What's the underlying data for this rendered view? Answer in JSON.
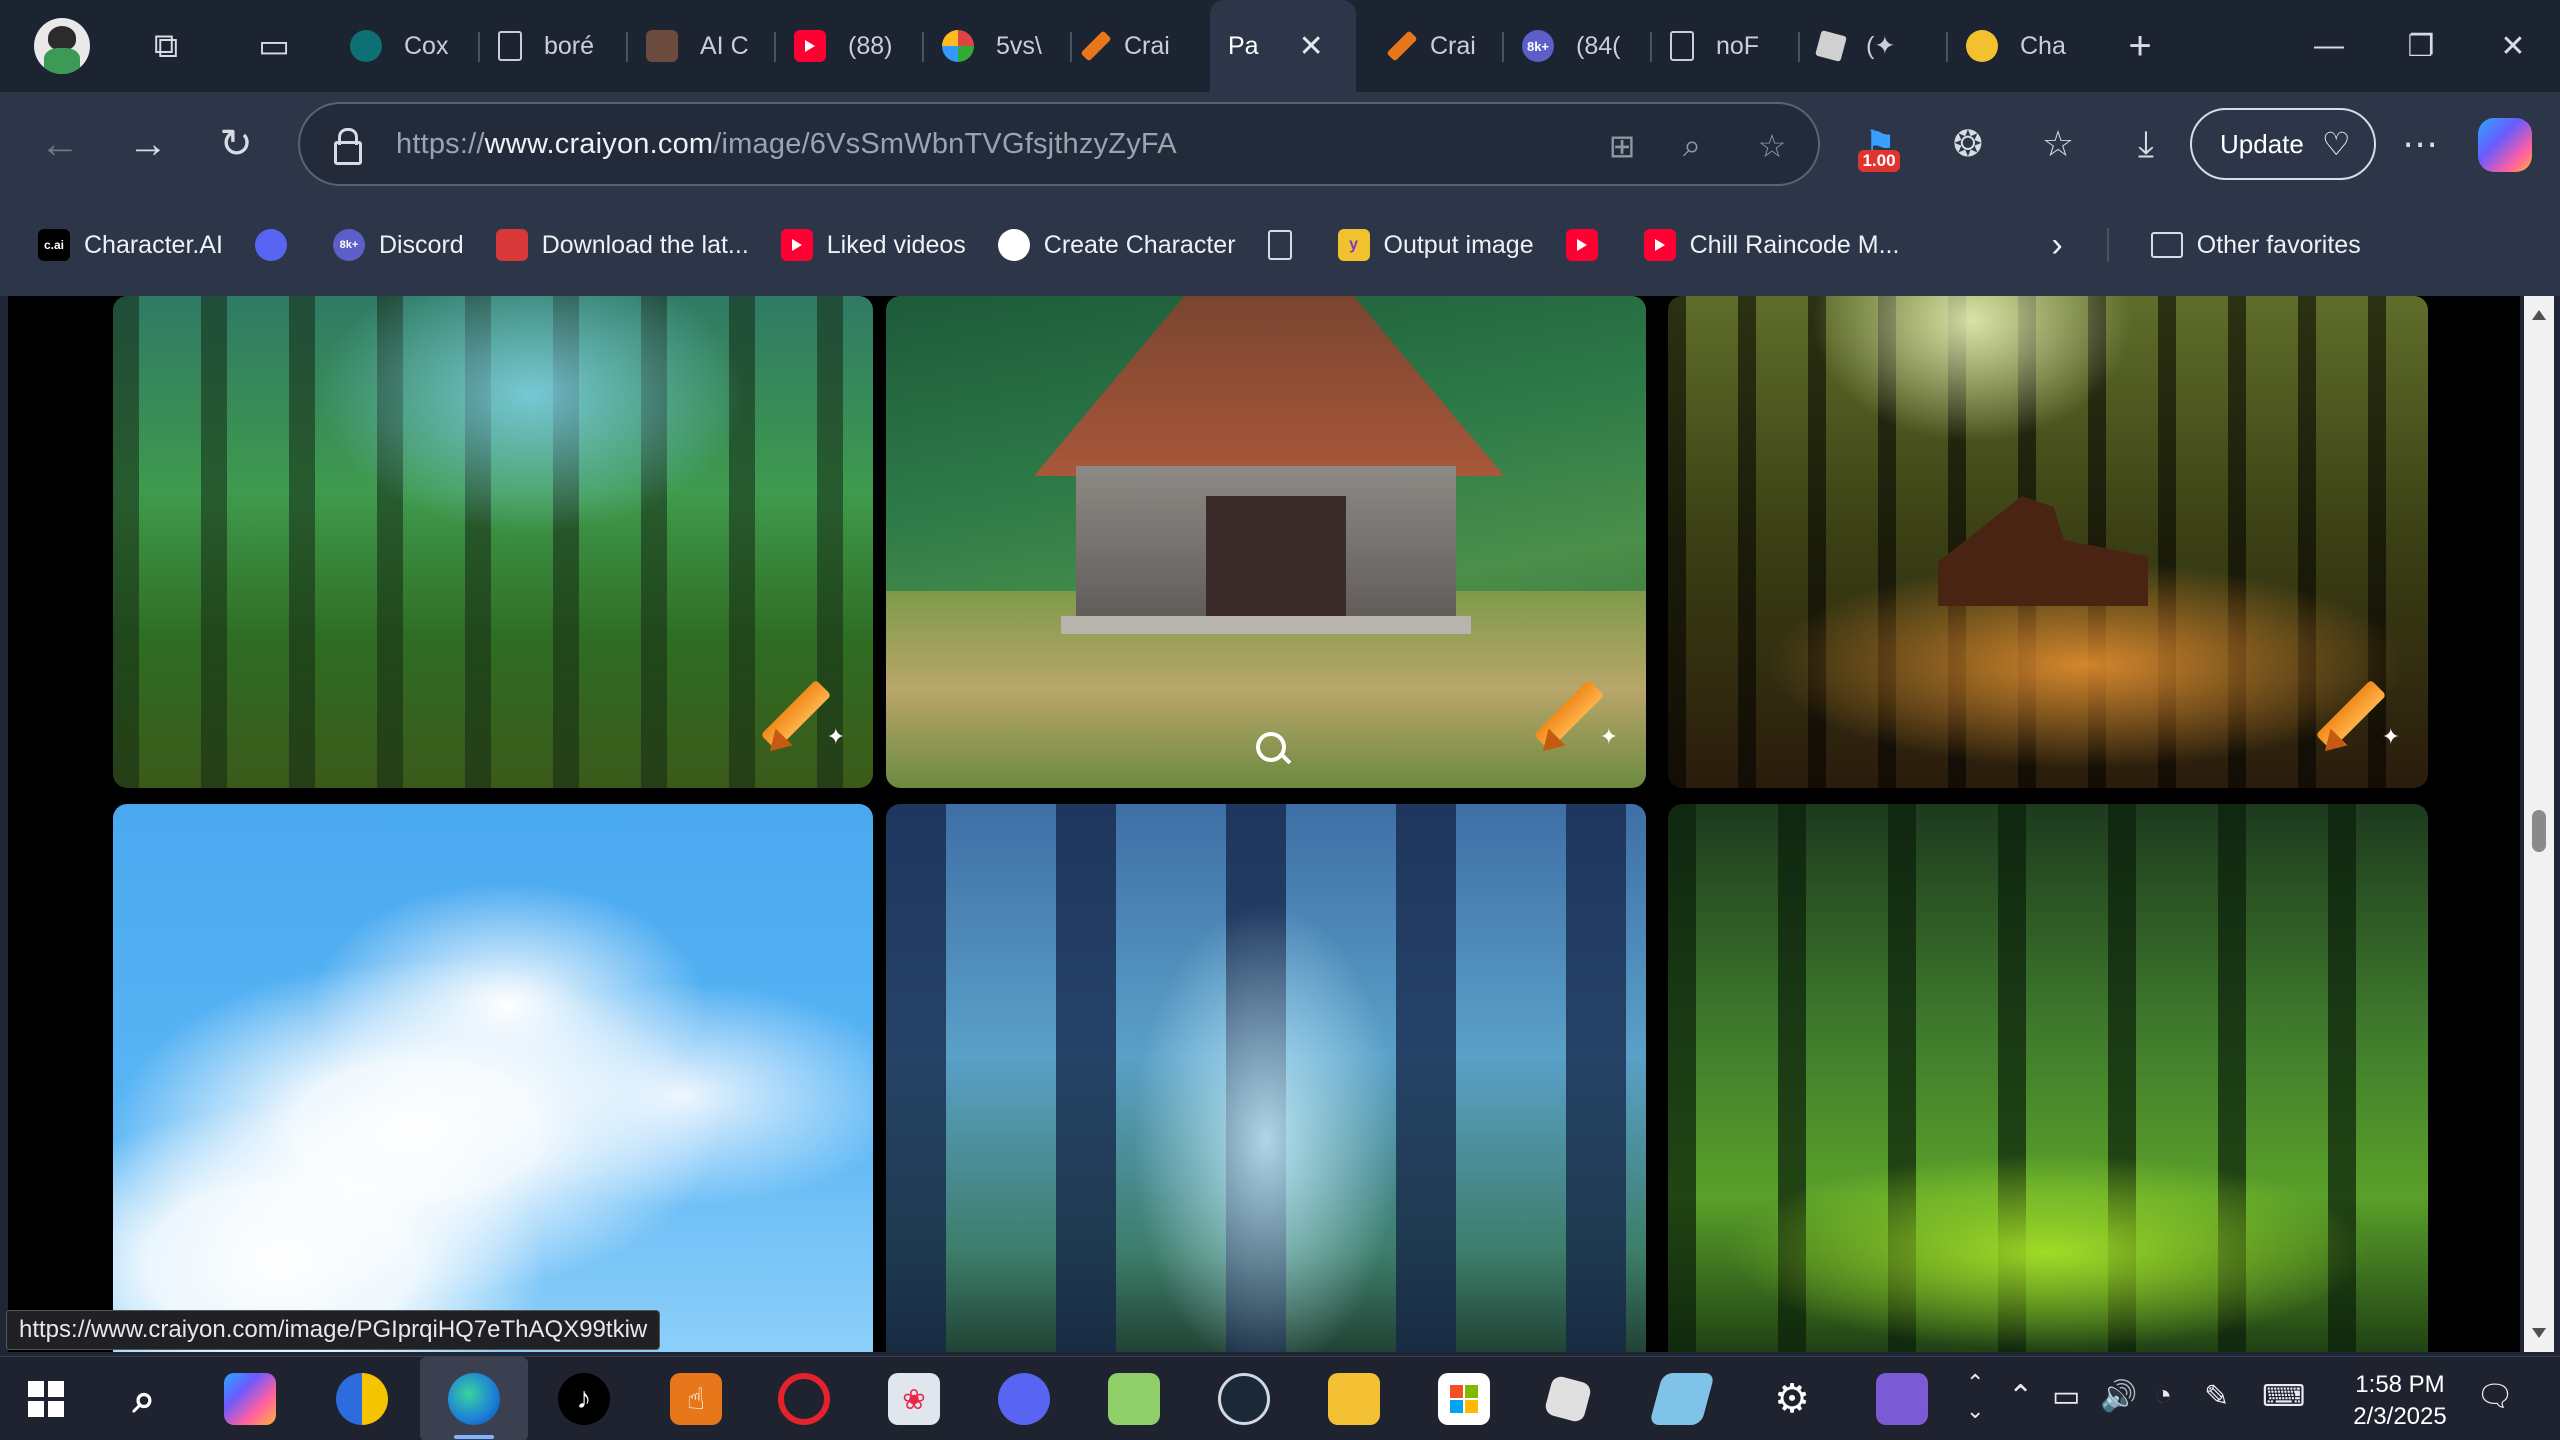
{
  "tabs": [
    {
      "title": "Cox",
      "color": "#0e6f74",
      "glyph": ""
    },
    {
      "title": "boré",
      "color": "#4a5262",
      "glyph": ""
    },
    {
      "title": "AI C",
      "color": "#6a4b3e",
      "glyph": ""
    },
    {
      "title": "(88)",
      "color": "#ff0033",
      "glyph": ""
    },
    {
      "title": "5vs\\",
      "color": "#3d7a3a",
      "glyph": ""
    },
    {
      "title": "Crai",
      "color": "#e8761a",
      "glyph": ""
    },
    {
      "title": "Pa",
      "color": "",
      "glyph": "",
      "active": true
    },
    {
      "title": "Crai",
      "color": "#e8761a",
      "glyph": ""
    },
    {
      "title": "(84(",
      "color": "#5b5fc7",
      "glyph": "8k+"
    },
    {
      "title": "noF",
      "color": "#4a5262",
      "glyph": ""
    },
    {
      "title": "(✦",
      "color": "#d0d0d0",
      "glyph": ""
    },
    {
      "title": "Cha",
      "color": "#f2c22e",
      "glyph": ""
    }
  ],
  "address": {
    "scheme_prefix": "https://",
    "host": "www.craiyon.com",
    "path": "/image/6VsSmWbnTVGfsjthzyZyFA"
  },
  "toolbar": {
    "extension_badge": "1.00",
    "update_label": "Update"
  },
  "favorites": [
    {
      "label": "Character.AI",
      "icon": "c.ai",
      "color": "#000000"
    },
    {
      "label": "",
      "icon": "discord",
      "color": "#5865f2"
    },
    {
      "label": "Discord",
      "icon": "8k+",
      "color": "#5b5fc7"
    },
    {
      "label": "Download the lat...",
      "icon": "download-page",
      "color": "#d9383a"
    },
    {
      "label": "Liked videos",
      "icon": "youtube",
      "color": "#ff0033"
    },
    {
      "label": "Create Character",
      "icon": "create-character",
      "color": "#ffffff"
    },
    {
      "label": "",
      "icon": "page",
      "color": "#4a5262"
    },
    {
      "label": "Output image",
      "icon": "output",
      "color": "#f2c22e"
    },
    {
      "label": "",
      "icon": "youtube",
      "color": "#ff0033"
    },
    {
      "label": "Chill Raincode M...",
      "icon": "youtube",
      "color": "#ff0033"
    }
  ],
  "other_favorites": "Other favorites",
  "status_url": "https://www.craiyon.com/image/PGIprqiHQ7eThAQX99tkiw",
  "gallery": {
    "row1": [
      "forest-path",
      "cabin-in-forest",
      "sunlit-bamboo-ruins"
    ],
    "row2": [
      "clouds-sky",
      "blue-forest-stream",
      "green-forest-hill"
    ]
  },
  "clock": {
    "time": "1:58 PM",
    "date": "2/3/2025"
  }
}
